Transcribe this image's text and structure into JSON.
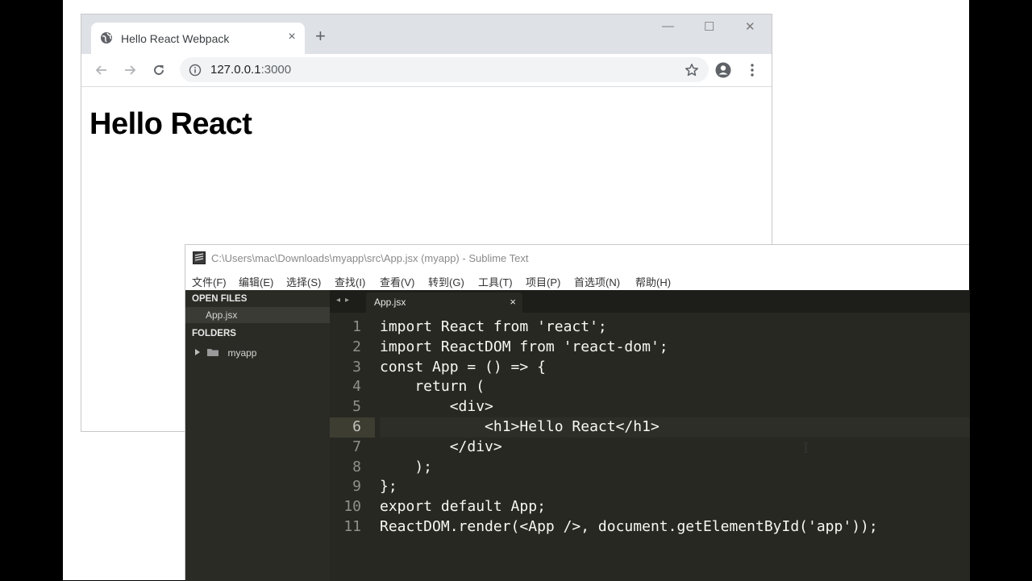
{
  "chrome": {
    "tab_title": "Hello React Webpack",
    "tab_close": "×",
    "new_tab": "+",
    "minimize": "—",
    "maximize": "☐",
    "close": "✕",
    "url_host": "127.0.0.1",
    "url_port": ":3000",
    "page_heading": "Hello React"
  },
  "sublime": {
    "window_title": "C:\\Users\\mac\\Downloads\\myapp\\src\\App.jsx (myapp) - Sublime Text",
    "menu": [
      "文件(F)",
      "编辑(E)",
      "选择(S)",
      "查找(I)",
      "查看(V)",
      "转到(G)",
      "工具(T)",
      "项目(P)",
      "首选项(N)",
      "帮助(H)"
    ],
    "sidebar": {
      "open_files_label": "OPEN FILES",
      "open_file": "App.jsx",
      "folders_label": "FOLDERS",
      "folder": "myapp"
    },
    "tab": {
      "name": "App.jsx",
      "close": "×",
      "arrows": "◂▸"
    },
    "code_lines": [
      "import React from 'react';",
      "import ReactDOM from 'react-dom';",
      "const App = () => {",
      "    return (",
      "        <div>",
      "            <h1>Hello React</h1>",
      "        </div>",
      "    );",
      "};",
      "export default App;",
      "ReactDOM.render(<App />, document.getElementById('app'));"
    ],
    "line_numbers": [
      "1",
      "2",
      "3",
      "4",
      "5",
      "6",
      "7",
      "8",
      "9",
      "10",
      "11"
    ],
    "current_line": 6,
    "mouse_cursor": "I"
  }
}
